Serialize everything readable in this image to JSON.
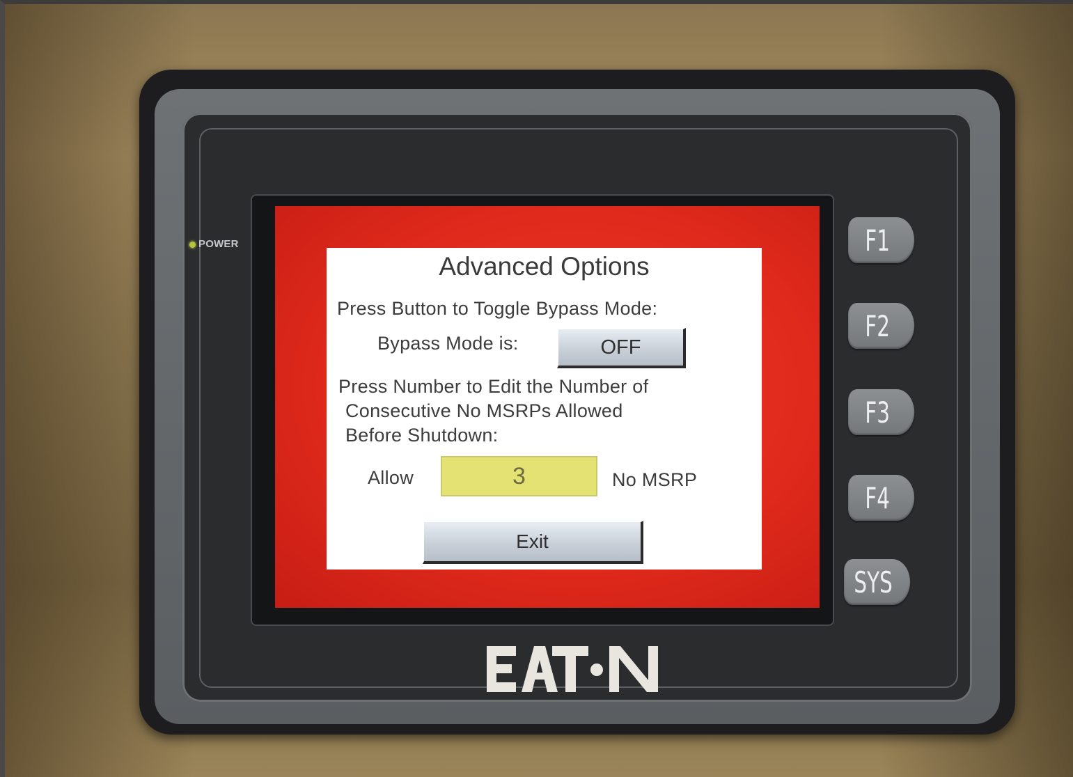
{
  "device": {
    "power_label": "POWER",
    "brand_name": "EATON"
  },
  "dialog": {
    "title": "Advanced Options",
    "toggle_prompt": "Press Button to Toggle Bypass Mode:",
    "bypass_label": "Bypass Mode is:",
    "bypass_value": "OFF",
    "edit_prompt_line1": "Press Number to Edit the Number of",
    "edit_prompt_line2": "Consecutive No MSRPs Allowed",
    "edit_prompt_line3": "Before Shutdown:",
    "allow_label": "Allow",
    "allow_value": "3",
    "unit_label": "No MSRP",
    "exit_label": "Exit"
  },
  "function_keys": [
    "F1",
    "F2",
    "F3",
    "F4",
    "SYS"
  ],
  "colors": {
    "screen_background": "#e02a1c",
    "dialog_background": "#ffffff",
    "number_field": "#e3e272",
    "power_led": "#b8c43a"
  }
}
